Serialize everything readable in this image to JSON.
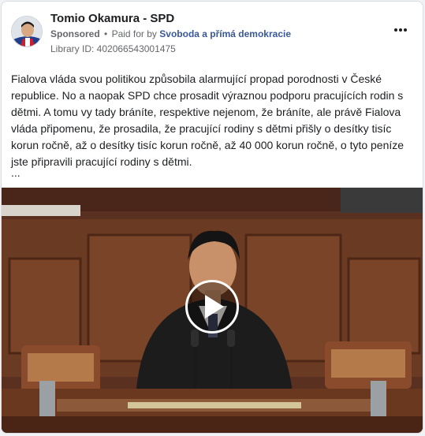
{
  "post": {
    "page_name": "Tomio Okamura - SPD",
    "sponsored_label": "Sponsored",
    "paid_for_label": "Paid for by",
    "payer": "Svoboda a přímá demokracie",
    "library_id": "Library ID: 402066543001475",
    "text": "Fialova vláda svou politikou způsobila alarmující propad porodnosti v České republice. No a naopak SPD chce prosadit výraznou podporu pracujících rodin s dětmi. A tomu vy tady bráníte, respektive nejenom, že bráníte, ale právě Fialova vláda připomenu, že prosadila, že pracující rodiny s dětmi přišly o desítky tisíc korun ročně, až o desítky tisíc korun ročně, až 40 000 korun ročně, o tyto peníze jste připravili pracující rodiny s dětmi.",
    "ellipsis": "...",
    "more_icon": "more-horizontal-icon",
    "play_icon": "play-icon"
  },
  "colors": {
    "link": "#385898",
    "secondary_text": "#65676b",
    "wood": "#6b3a22"
  }
}
